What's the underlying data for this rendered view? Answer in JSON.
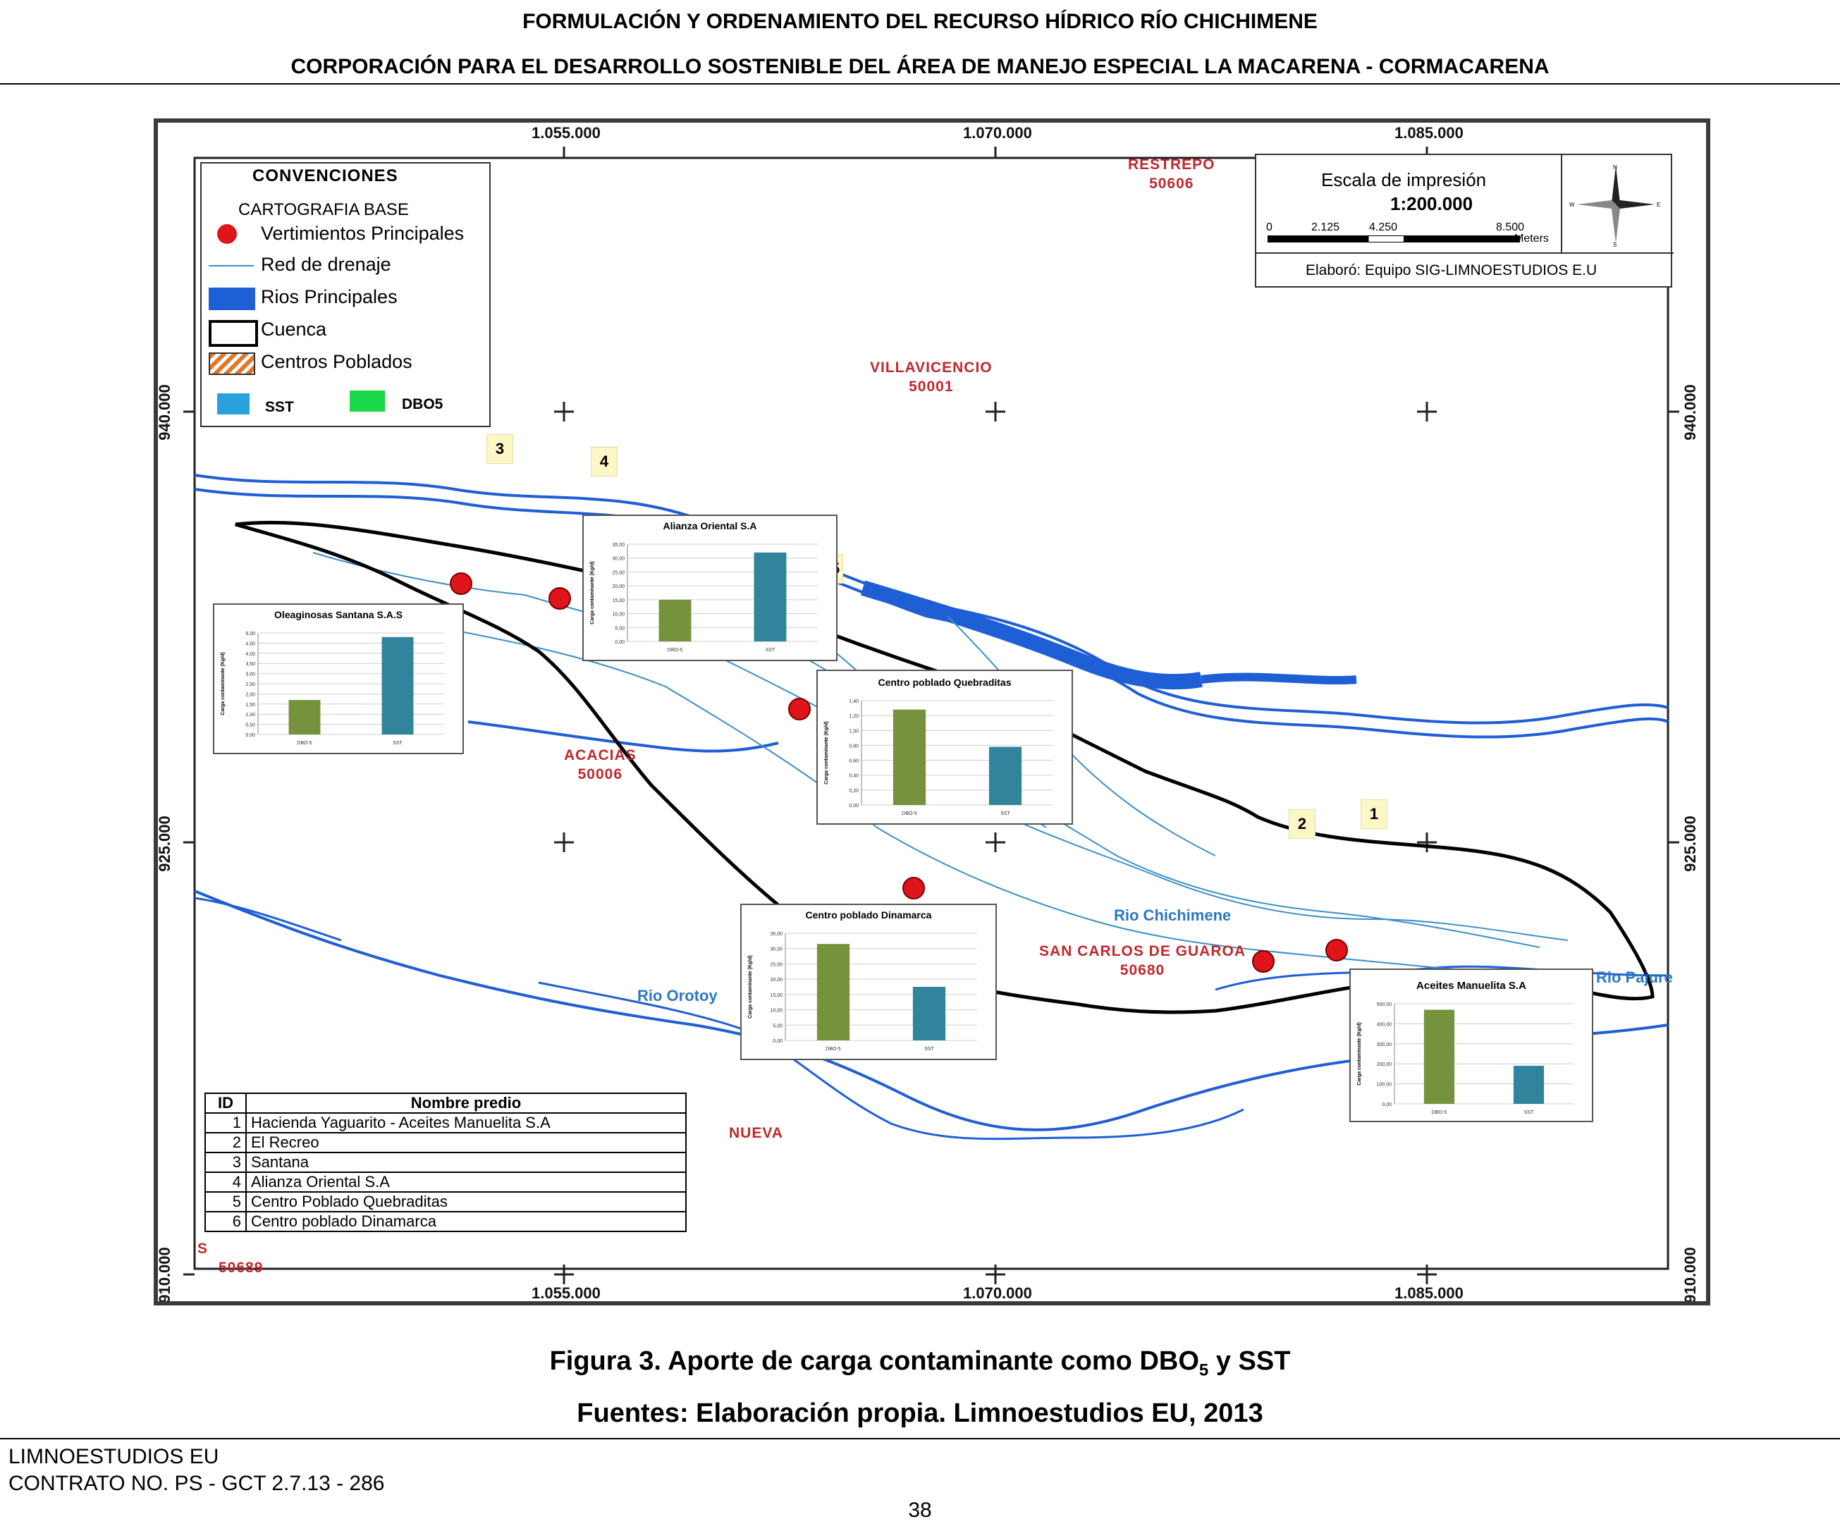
{
  "header": {
    "line1": "FORMULACIÓN Y ORDENAMIENTO DEL RECURSO HÍDRICO RÍO CHICHIMENE",
    "line2": "CORPORACIÓN PARA EL DESARROLLO SOSTENIBLE DEL ÁREA DE MANEJO ESPECIAL LA MACARENA - CORMACARENA"
  },
  "map": {
    "coords_x": [
      "1.055.000",
      "1.070.000",
      "1.085.000"
    ],
    "coords_y": [
      "940.000",
      "925.000",
      "910.000"
    ],
    "legend": {
      "title": "CONVENCIONES",
      "subtitle": "CARTOGRAFIA BASE",
      "items": [
        "Vertimientos Principales",
        "Red de drenaje",
        "Rios Principales",
        "Cuenca",
        "Centros Poblados"
      ],
      "series": [
        "SST",
        "DBO5"
      ]
    },
    "scale": {
      "title": "Escala de impresión",
      "ratio": "1:200.000",
      "ticks": [
        "0",
        "2.125",
        "4.250",
        "8.500"
      ],
      "unit": "Meters",
      "credit": "Elaboró: Equipo SIG-LIMNOESTUDIOS E.U"
    },
    "places": [
      {
        "name": "RESTREPO",
        "code": "50606"
      },
      {
        "name": "VILLAVICENCIO",
        "code": "50001"
      },
      {
        "name": "ACACIAS",
        "code": "50006"
      },
      {
        "name": "SAN CARLOS DE GUAROA",
        "code": "50680"
      },
      {
        "name": "NUEVA",
        "code": ""
      },
      {
        "name": "S",
        "code": "50689"
      }
    ],
    "rivers": [
      "Rio Chichimene",
      "Rio Orotoy",
      "Rio Pajure"
    ],
    "id_tags": [
      "1",
      "2",
      "3",
      "4",
      "5"
    ],
    "table": {
      "headers": [
        "ID",
        "Nombre predio"
      ],
      "rows": [
        [
          "1",
          "Hacienda Yaguarito - Aceites Manuelita S.A"
        ],
        [
          "2",
          "El Recreo"
        ],
        [
          "3",
          "Santana"
        ],
        [
          "4",
          "Alianza Oriental S.A"
        ],
        [
          "5",
          "Centro Poblado Quebraditas"
        ],
        [
          "6",
          "Centro poblado Dinamarca"
        ]
      ]
    },
    "colors": {
      "dbo5": "#76923c",
      "sst": "#31849b",
      "river": "#1f5fd6",
      "drain": "#3b8fc8",
      "point": "#e0141b"
    }
  },
  "chart_data": [
    {
      "type": "bar",
      "title": "Oleaginosas Santana S.A.S",
      "categories": [
        "DBO-5",
        "SST"
      ],
      "values": [
        1.7,
        4.8
      ],
      "ylabel": "Carga contaminante (Kg/d)",
      "ylim": [
        0,
        5
      ],
      "ticks": [
        "0,00",
        "0,50",
        "1,00",
        "1,50",
        "2,00",
        "2,50",
        "3,00",
        "3,50",
        "4,00",
        "4,50",
        "5,00"
      ]
    },
    {
      "type": "bar",
      "title": "Alianza Oriental S.A",
      "categories": [
        "DBO-5",
        "SST"
      ],
      "values": [
        15,
        32
      ],
      "ylabel": "Carga contaminante (Kg/d)",
      "ylim": [
        0,
        35
      ],
      "ticks": [
        "0,00",
        "5,00",
        "10,00",
        "15,00",
        "20,00",
        "25,00",
        "30,00",
        "35,00"
      ]
    },
    {
      "type": "bar",
      "title": "Centro poblado Quebraditas",
      "categories": [
        "DBO-5",
        "SST"
      ],
      "values": [
        1.28,
        0.78
      ],
      "ylabel": "Carga contaminante (Kg/d)",
      "ylim": [
        0,
        1.4
      ],
      "ticks": [
        "0,00",
        "0,20",
        "0,40",
        "0,60",
        "0,80",
        "1,00",
        "1,20",
        "1,40"
      ]
    },
    {
      "type": "bar",
      "title": "Centro poblado Dinamarca",
      "categories": [
        "DBO-5",
        "SST"
      ],
      "values": [
        31.5,
        17.5
      ],
      "ylabel": "Carga contaminante (Kg/d)",
      "ylim": [
        0,
        35
      ],
      "ticks": [
        "0,00",
        "5,00",
        "10,00",
        "15,00",
        "20,00",
        "25,00",
        "30,00",
        "35,00"
      ]
    },
    {
      "type": "bar",
      "title": "Aceites Manuelita S.A",
      "categories": [
        "DBO-5",
        "SST"
      ],
      "values": [
        470,
        190
      ],
      "ylabel": "Carga contaminante (Kg/d)",
      "ylim": [
        0,
        500
      ],
      "ticks": [
        "0,00",
        "100,00",
        "200,00",
        "300,00",
        "400,00",
        "500,00"
      ]
    }
  ],
  "caption": {
    "figure_prefix": "Figura 3. Aporte de carga contaminante como DBO",
    "figure_sub": "5",
    "figure_suffix": " y SST",
    "source": "Fuentes: Elaboración propia. Limnoestudios EU, 2013"
  },
  "footer": {
    "company": "LIMNOESTUDIOS EU",
    "contract": "CONTRATO NO. PS - GCT 2.7.13 - 286",
    "page": "38"
  }
}
